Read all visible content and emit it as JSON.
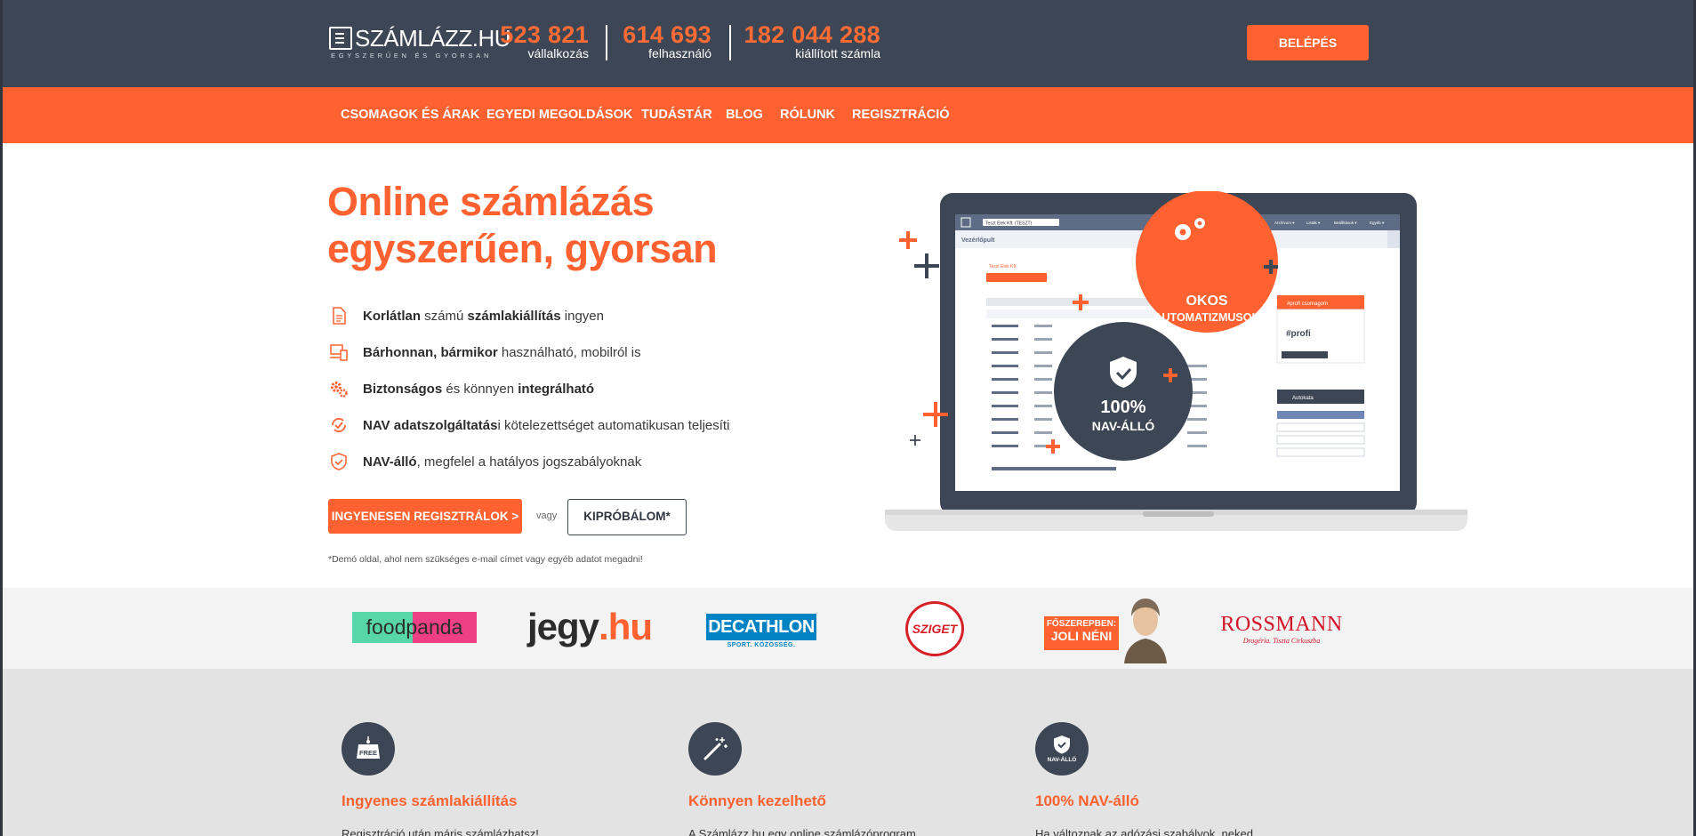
{
  "header": {
    "logo_text": "SZÁMLÁZZ.HU",
    "logo_tagline": "EGYSZERŰEN ÉS GYORSAN",
    "stats": [
      {
        "value": "523 821",
        "label": "vállalkozás"
      },
      {
        "value": "614 693",
        "label": "felhasználó"
      },
      {
        "value": "182 044 288",
        "label": "kiállított számla"
      }
    ],
    "login_label": "BELÉPÉS"
  },
  "nav": {
    "items": [
      "CSOMAGOK ÉS ÁRAK",
      "EGYEDI MEGOLDÁSOK",
      "TUDÁSTÁR",
      "BLOG",
      "RÓLUNK",
      "REGISZTRÁCIÓ"
    ]
  },
  "hero": {
    "title_line1": "Online számlázás",
    "title_line2": "egyszerűen, gyorsan",
    "features": [
      {
        "icon": "document-icon",
        "parts": [
          {
            "b": "Korlátlan"
          },
          {
            "t": " számú "
          },
          {
            "b": "számlakiállítás"
          },
          {
            "t": " ingyen"
          }
        ]
      },
      {
        "icon": "devices-icon",
        "parts": [
          {
            "b": "Bárhonnan, bármikor"
          },
          {
            "t": " használható, mobilról is"
          }
        ]
      },
      {
        "icon": "gears-icon",
        "parts": [
          {
            "b": "Biztonságos"
          },
          {
            "t": " és könnyen "
          },
          {
            "b": "integrálható"
          }
        ]
      },
      {
        "icon": "sync-check-icon",
        "parts": [
          {
            "b": "NAV adatszolgáltatás"
          },
          {
            "t": "i kötelezettséget automatikusan teljesíti"
          }
        ]
      },
      {
        "icon": "shield-check-icon",
        "parts": [
          {
            "b": "NAV-álló"
          },
          {
            "t": ", megfelel a hatályos jogszabályoknak"
          }
        ]
      }
    ],
    "cta_primary": "INGYENESEN REGISZTRÁLOK >",
    "cta_or": "vagy",
    "cta_secondary": "KIPRÓBÁLOM*",
    "note": "*Demó oldal, ahol nem szükséges e-mail címet vagy egyéb adatot megadni!"
  },
  "illustration": {
    "badge_okos_line1": "OKOS",
    "badge_okos_line2": "AUTOMATIZMUSOK",
    "badge_nav_line1": "100%",
    "badge_nav_line2": "NAV-ÁLLÓ",
    "screen_title": "Vezérlőpult",
    "screen_company": "Teszt Elek Kft. (TESZT)",
    "screen_package": "#profi",
    "screen_package_label": "#profi csomagom",
    "screen_autokata": "Autokata"
  },
  "partners": {
    "foodpanda": "foodpanda",
    "jegy_main": "jegy",
    "jegy_tld": ".hu",
    "decathlon": "DECATHLON",
    "decathlon_sub": "SPORT. KÖZÖSSÉG.",
    "sziget": "SZIGET",
    "joli_line1": "FŐSZEREPBEN:",
    "joli_line2": "JOLI NÉNI",
    "rossmann": "ROSSMANN",
    "rossmann_sub": "Drogéria. Tiszta Cirkuszba"
  },
  "features_row": [
    {
      "icon": "free-tag-icon",
      "badge": "FREE",
      "title": "Ingyenes számlakiállítás",
      "text": "Regisztráció után máris számlázhatsz!"
    },
    {
      "icon": "magic-wand-icon",
      "badge": "",
      "title": "Könnyen kezelhető",
      "text": "A Számlázz.hu egy online számlázóprogram"
    },
    {
      "icon": "shield-check-icon",
      "badge": "NAV-ÁLLÓ",
      "title": "100% NAV-álló",
      "text": "Ha változnak az adózási szabályok, neked"
    }
  ],
  "colors": {
    "brand_orange": "#ff6230",
    "header_dark": "#3d4655",
    "logos_bg": "#f3f3f3",
    "lower_bg": "#e3e3e3"
  }
}
